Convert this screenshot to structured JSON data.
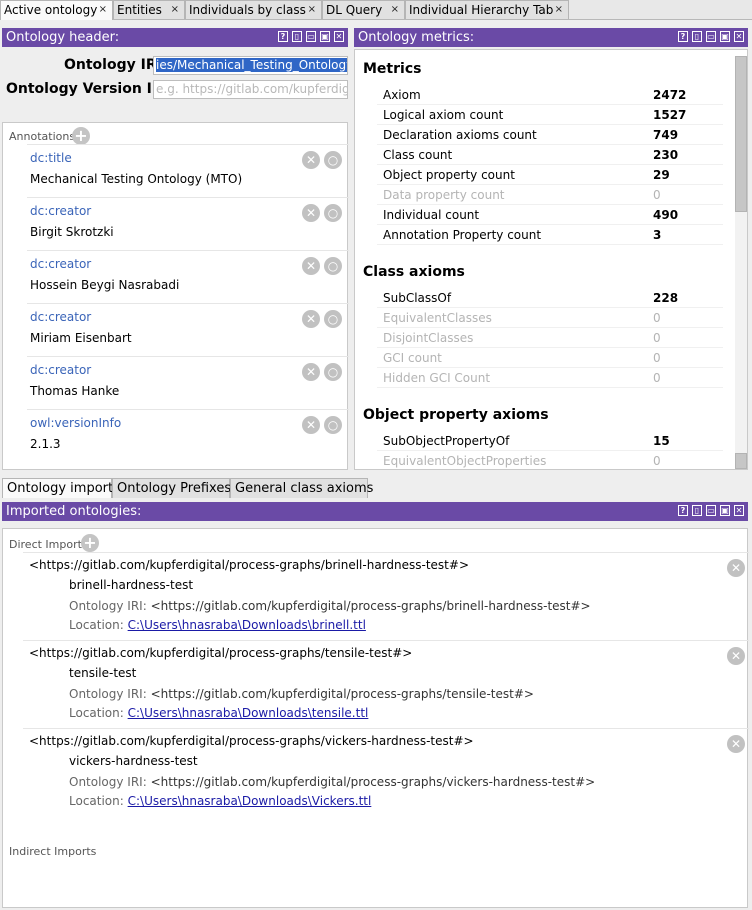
{
  "tabs": [
    {
      "label": "Active ontology",
      "close": "×"
    },
    {
      "label": "Entities",
      "close": "×"
    },
    {
      "label": "Individuals by class",
      "close": "×"
    },
    {
      "label": "DL Query",
      "close": "×"
    },
    {
      "label": "Individual Hierarchy Tab",
      "close": "×"
    }
  ],
  "panel_controls": [
    "?",
    "▯",
    "▭",
    "▣",
    "✕"
  ],
  "header_panel": {
    "title": "Ontology header:",
    "iri_label": "Ontology IRI",
    "iri_value": "ies/Mechanical_Testing_Ontology/",
    "version_label": "Ontology Version IRI",
    "version_placeholder": "e.g. https://gitlab.com/kupferdigital/",
    "annotations_label": "Annotations",
    "annotations": [
      {
        "property": "dc:title",
        "value": "Mechanical Testing Ontology (MTO)"
      },
      {
        "property": "dc:creator",
        "value": "Birgit Skrotzki"
      },
      {
        "property": "dc:creator",
        "value": "Hossein Beygi Nasrabadi"
      },
      {
        "property": "dc:creator",
        "value": "Miriam Eisenbart"
      },
      {
        "property": "dc:creator",
        "value": "Thomas Hanke"
      },
      {
        "property": "owl:versionInfo",
        "value": "2.1.3"
      }
    ]
  },
  "metrics_panel": {
    "title": "Ontology metrics:",
    "metrics_title": "Metrics",
    "metrics": [
      {
        "name": "Axiom",
        "value": "2472",
        "dim": false
      },
      {
        "name": "Logical axiom count",
        "value": "1527",
        "dim": false
      },
      {
        "name": "Declaration axioms count",
        "value": "749",
        "dim": false
      },
      {
        "name": "Class count",
        "value": "230",
        "dim": false
      },
      {
        "name": "Object property count",
        "value": "29",
        "dim": false
      },
      {
        "name": "Data property count",
        "value": "0",
        "dim": true
      },
      {
        "name": "Individual count",
        "value": "490",
        "dim": false
      },
      {
        "name": "Annotation Property count",
        "value": "3",
        "dim": false
      }
    ],
    "class_axioms_title": "Class axioms",
    "class_axioms": [
      {
        "name": "SubClassOf",
        "value": "228",
        "dim": false
      },
      {
        "name": "EquivalentClasses",
        "value": "0",
        "dim": true
      },
      {
        "name": "DisjointClasses",
        "value": "0",
        "dim": true
      },
      {
        "name": "GCI count",
        "value": "0",
        "dim": true
      },
      {
        "name": "Hidden GCI Count",
        "value": "0",
        "dim": true
      }
    ],
    "object_property_axioms_title": "Object property axioms",
    "object_property_axioms": [
      {
        "name": "SubObjectPropertyOf",
        "value": "15",
        "dim": false
      },
      {
        "name": "EquivalentObjectProperties",
        "value": "0",
        "dim": true
      }
    ]
  },
  "bottom_tabs": [
    {
      "label": "Ontology imports"
    },
    {
      "label": "Ontology Prefixes"
    },
    {
      "label": "General class axioms"
    }
  ],
  "imports_panel": {
    "title": "Imported ontologies:",
    "direct_label": "Direct Imports",
    "indirect_label": "Indirect Imports",
    "oi_label": "Ontology IRI:",
    "loc_label": "Location:",
    "imports": [
      {
        "header": "<https://gitlab.com/kupferdigital/process-graphs/brinell-hardness-test#>",
        "name": "brinell-hardness-test",
        "iri": "<https://gitlab.com/kupferdigital/process-graphs/brinell-hardness-test#>",
        "location": "C:\\Users\\hnasraba\\Downloads\\brinell.ttl"
      },
      {
        "header": "<https://gitlab.com/kupferdigital/process-graphs/tensile-test#>",
        "name": "tensile-test",
        "iri": "<https://gitlab.com/kupferdigital/process-graphs/tensile-test#>",
        "location": "C:\\Users\\hnasraba\\Downloads\\tensile.ttl"
      },
      {
        "header": "<https://gitlab.com/kupferdigital/process-graphs/vickers-hardness-test#>",
        "name": "vickers-hardness-test",
        "iri": "<https://gitlab.com/kupferdigital/process-graphs/vickers-hardness-test#>",
        "location": "C:\\Users\\hnasraba\\Downloads\\Vickers.ttl"
      }
    ]
  }
}
